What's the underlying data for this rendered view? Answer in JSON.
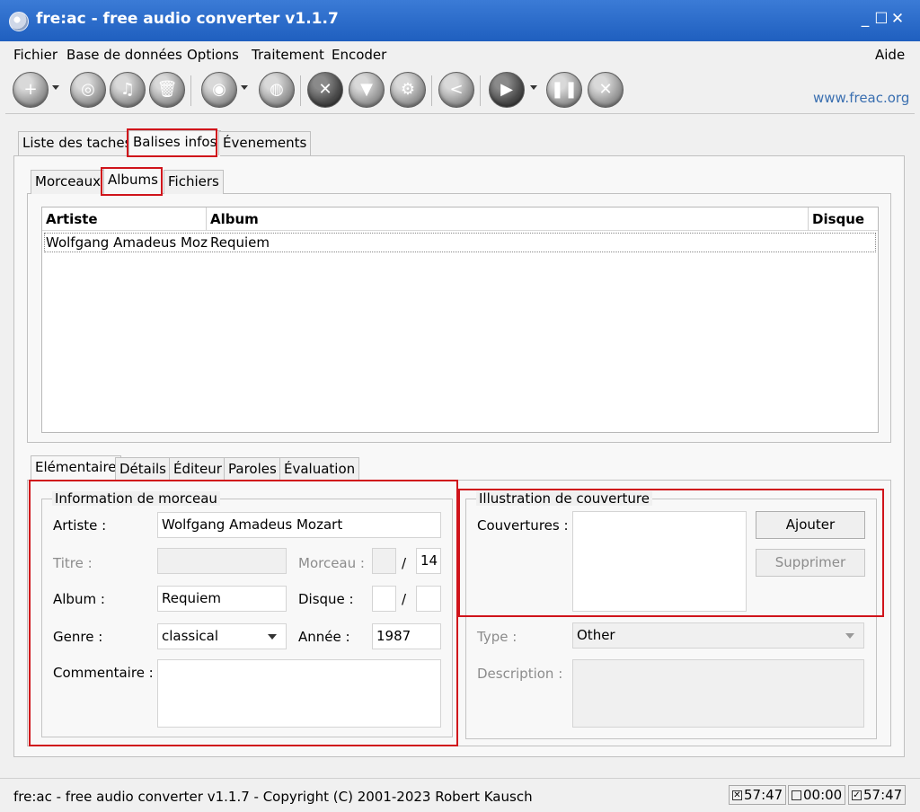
{
  "window": {
    "title": "fre:ac - free audio converter v1.1.7",
    "controls": [
      "_",
      "☐",
      "✕"
    ]
  },
  "menu": {
    "items": [
      "Fichier",
      "Base de données",
      "Options",
      "Traitement",
      "Encoder"
    ],
    "help": "Aide"
  },
  "toolbar": {
    "website": "www.freac.org",
    "icons": [
      "add-files-icon",
      "add-cd-icon",
      "music-icon",
      "trash-icon",
      "query-cddb-icon",
      "submit-cddb-icon",
      "configure-icon",
      "filter-icon",
      "settings-icon",
      "share-icon",
      "play-icon",
      "pause-icon",
      "stop-icon"
    ]
  },
  "main_tabs": [
    "Liste des taches",
    "Balises infos",
    "Évenements"
  ],
  "sub_tabs": [
    "Morceaux",
    "Albums",
    "Fichiers"
  ],
  "albums_table": {
    "columns": [
      "Artiste",
      "Album",
      "Disque"
    ],
    "rows": [
      {
        "artist": "Wolfgang Amadeus Moz",
        "album": "Requiem",
        "disc": ""
      }
    ]
  },
  "detail_tabs": [
    "Elémentaire",
    "Détails",
    "Éditeur",
    "Paroles",
    "Évaluation"
  ],
  "track_info": {
    "group_title": "Information de morceau",
    "artist_label": "Artiste :",
    "artist_value": "Wolfgang Amadeus Mozart",
    "title_label": "Titre :",
    "title_value": "",
    "track_label": "Morceau :",
    "track_value": "",
    "track_sep": "/",
    "track_total": "14",
    "album_label": "Album :",
    "album_value": "Requiem",
    "disc_label": "Disque :",
    "disc_value": "",
    "disc_sep": "/",
    "disc_total": "",
    "genre_label": "Genre :",
    "genre_value": "classical",
    "year_label": "Année :",
    "year_value": "1987",
    "comment_label": "Commentaire :",
    "comment_value": ""
  },
  "cover_art": {
    "group_title": "Illustration de couverture",
    "covers_label": "Couvertures :",
    "add_button": "Ajouter",
    "remove_button": "Supprimer",
    "type_label": "Type :",
    "type_value": "Other",
    "description_label": "Description :",
    "description_value": ""
  },
  "status": {
    "text": "fre:ac - free audio converter v1.1.7 - Copyright (C) 2001-2023 Robert Kausch",
    "time1": "57:47",
    "time2": "00:00",
    "time3": "57:47"
  }
}
